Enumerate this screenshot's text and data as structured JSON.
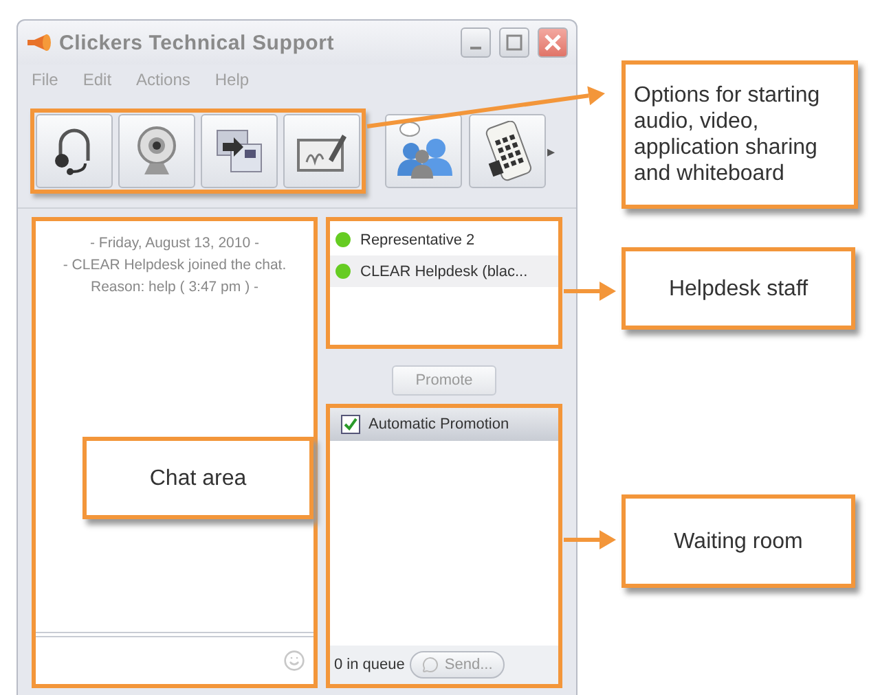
{
  "window": {
    "title": "Clickers Technical Support"
  },
  "menu": [
    "File",
    "Edit",
    "Actions",
    "Help"
  ],
  "toolbar": [
    {
      "kind": "headset",
      "highlighted": true
    },
    {
      "kind": "webcam",
      "highlighted": true
    },
    {
      "kind": "share",
      "highlighted": true
    },
    {
      "kind": "whiteboard",
      "highlighted": true
    },
    {
      "kind": "people",
      "highlighted": false
    },
    {
      "kind": "keypad",
      "highlighted": false
    }
  ],
  "toolbar_more": "▸",
  "chat": {
    "messages": [
      "- Friday, August 13, 2010 -",
      "- CLEAR Helpdesk joined the chat.",
      "Reason: help ( 3:47 pm ) -"
    ]
  },
  "staff": [
    {
      "name": "Representative 2",
      "color": "#66cc22",
      "selected": false
    },
    {
      "name": "CLEAR Helpdesk (blac...",
      "color": "#66cc22",
      "selected": true
    }
  ],
  "promote": {
    "label": "Promote",
    "disabled": true
  },
  "waiting_room": {
    "auto_promotion": {
      "label": "Automatic Promotion",
      "checked": true
    },
    "queue": "0 in queue",
    "send": "Send..."
  },
  "callouts": [
    {
      "text": "Options for starting audio, video, application sharing and whiteboard"
    },
    {
      "text": "Helpdesk staff"
    },
    {
      "text": "Chat area"
    },
    {
      "text": "Waiting room"
    }
  ]
}
